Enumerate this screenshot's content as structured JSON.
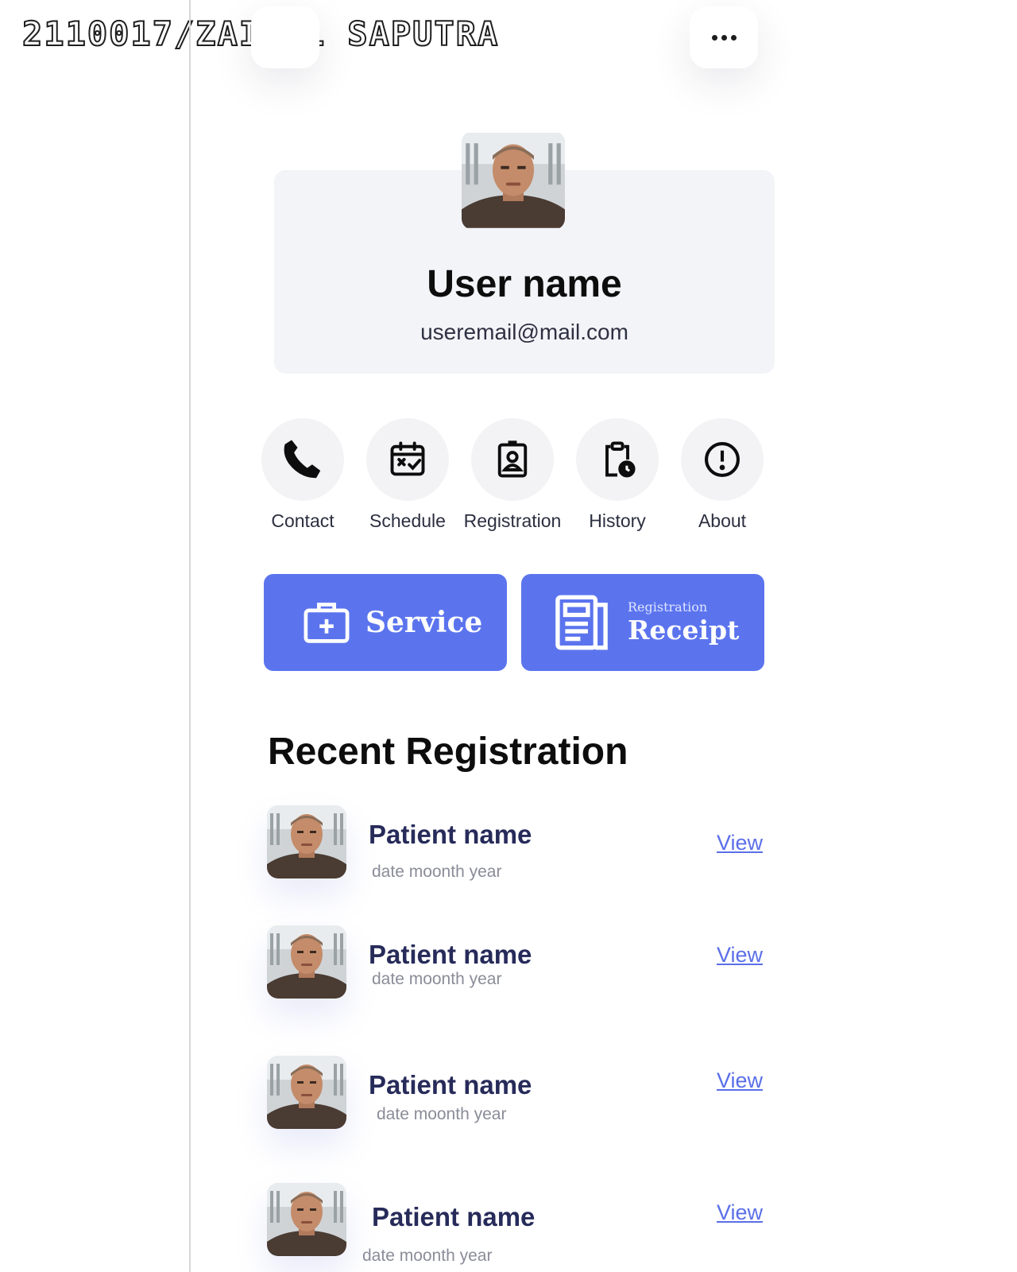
{
  "watermark": "2110017/ZAINAL SAPUTRA",
  "header": {
    "more_icon": "more-dots-icon",
    "back_icon": "back-icon"
  },
  "profile": {
    "name": "User name",
    "email": "useremail@mail.com"
  },
  "actions": [
    {
      "label": "Contact",
      "icon": "phone-icon"
    },
    {
      "label": "Schedule",
      "icon": "calendar-check-icon"
    },
    {
      "label": "Registration",
      "icon": "id-badge-icon"
    },
    {
      "label": "History",
      "icon": "clipboard-clock-icon"
    },
    {
      "label": "About",
      "icon": "info-alert-icon"
    }
  ],
  "buttons": {
    "service": {
      "label": "Service",
      "icon": "medical-kit-icon"
    },
    "receipt": {
      "small": "Registration",
      "label": "Receipt",
      "icon": "document-icon"
    }
  },
  "recent": {
    "title": "Recent Registration",
    "items": [
      {
        "name": "Patient name",
        "date": "date moonth year",
        "action": "View"
      },
      {
        "name": "Patient name",
        "date": "date moonth year",
        "action": "View"
      },
      {
        "name": "Patient name",
        "date": "date moonth year",
        "action": "View"
      },
      {
        "name": "Patient name",
        "date": "date moonth year",
        "action": "View"
      }
    ]
  },
  "colors": {
    "accent": "#5b74ee",
    "name_text": "#272b5a",
    "card_bg": "#f3f4f8"
  }
}
